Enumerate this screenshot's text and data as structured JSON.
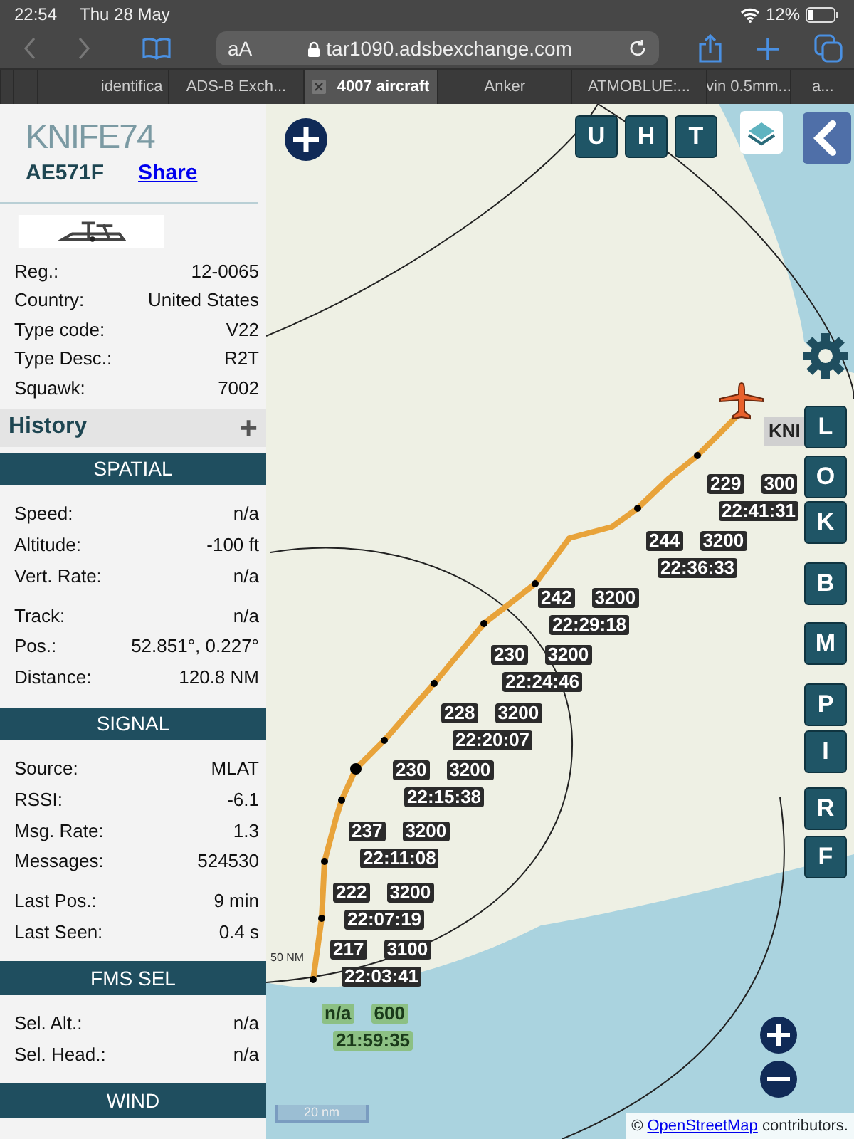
{
  "status_bar": {
    "time": "22:54",
    "date": "Thu 28 May",
    "battery": "12%"
  },
  "address_bar": {
    "text_size": "aA",
    "url": "tar1090.adsbexchange.com"
  },
  "tabs": [
    {
      "label": "identifica",
      "selected": false
    },
    {
      "label": "ADS-B Exch...",
      "selected": false
    },
    {
      "label": "4007 aircraft",
      "selected": true
    },
    {
      "label": "Anker",
      "selected": false
    },
    {
      "label": "ATMOBLUE:...",
      "selected": false
    },
    {
      "label": "vin 0.5mm...",
      "selected": false
    },
    {
      "label": "a...",
      "selected": false
    }
  ],
  "aircraft": {
    "callsign": "KNIFE74",
    "hex": "AE571F",
    "share": "Share",
    "details": [
      {
        "label": "Reg.:",
        "value": "12-0065"
      },
      {
        "label": "Country:",
        "value": "United States"
      },
      {
        "label": "Type code:",
        "value": "V22"
      },
      {
        "label": "Type Desc.:",
        "value": "R2T"
      },
      {
        "label": "Squawk:",
        "value": "7002"
      }
    ]
  },
  "history": {
    "title": "History",
    "toggle": "+"
  },
  "sections": [
    {
      "title": "SPATIAL",
      "groups": [
        {
          "rows": [
            {
              "label": "Speed:",
              "value": "n/a"
            },
            {
              "label": "Altitude:",
              "value": "-100 ft"
            },
            {
              "label": "Vert. Rate:",
              "value": "n/a"
            }
          ]
        },
        {
          "rows": [
            {
              "label": "Track:",
              "value": "n/a"
            },
            {
              "label": "Pos.:",
              "value": "52.851°, 0.227°"
            },
            {
              "label": "Distance:",
              "value": "120.8 NM"
            }
          ]
        }
      ]
    },
    {
      "title": "SIGNAL",
      "groups": [
        {
          "rows": [
            {
              "label": "Source:",
              "value": "MLAT"
            },
            {
              "label": "RSSI:",
              "value": "-6.1"
            },
            {
              "label": "Msg. Rate:",
              "value": "1.3"
            },
            {
              "label": "Messages:",
              "value": "524530"
            }
          ]
        },
        {
          "rows": [
            {
              "label": "Last Pos.:",
              "value": "9 min"
            },
            {
              "label": "Last Seen:",
              "value": "0.4 s"
            }
          ]
        }
      ]
    },
    {
      "title": "FMS SEL",
      "groups": [
        {
          "rows": [
            {
              "label": "Sel. Alt.:",
              "value": "n/a"
            },
            {
              "label": "Sel. Head.:",
              "value": "n/a"
            }
          ]
        }
      ]
    },
    {
      "title": "WIND"
    }
  ],
  "map": {
    "top_buttons": [
      "U",
      "H",
      "T"
    ],
    "side_buttons": [
      "L",
      "O",
      "K",
      "B",
      "M",
      "P",
      "I",
      "R",
      "F"
    ],
    "aircraft_label": "KNI",
    "ring_label": "50 NM",
    "scale": "20 nm",
    "attribution_prefix": "©",
    "attribution_link": "OpenStreetMap",
    "attribution_suffix": "contributors.",
    "track_labels": [
      {
        "speed": "229",
        "altitude": "300",
        "time": "22:41:31",
        "color": "#2b2b2b"
      },
      {
        "speed": "244",
        "altitude": "3200",
        "time": "22:36:33",
        "color": "#2b2b2b"
      },
      {
        "speed": "242",
        "altitude": "3200",
        "time": "22:29:18",
        "color": "#2b2b2b"
      },
      {
        "speed": "230",
        "altitude": "3200",
        "time": "22:24:46",
        "color": "#2b2b2b"
      },
      {
        "speed": "228",
        "altitude": "3200",
        "time": "22:20:07",
        "color": "#2b2b2b"
      },
      {
        "speed": "230",
        "altitude": "3200",
        "time": "22:15:38",
        "color": "#2b2b2b"
      },
      {
        "speed": "237",
        "altitude": "3200",
        "time": "22:11:08",
        "color": "#2b2b2b"
      },
      {
        "speed": "222",
        "altitude": "3200",
        "time": "22:07:19",
        "color": "#2b2b2b"
      },
      {
        "speed": "217",
        "altitude": "3100",
        "time": "22:03:41",
        "color": "#2b2b2b"
      },
      {
        "speed": "n/a",
        "altitude": "600",
        "time": "21:59:35",
        "color": "#8cc084"
      }
    ]
  }
}
